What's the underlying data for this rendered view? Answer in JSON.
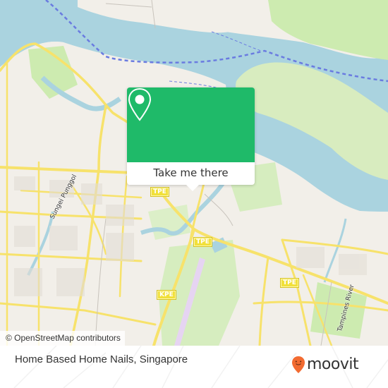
{
  "map": {
    "attribution": "© OpenStreetMap contributors",
    "highway_shields": [
      {
        "label": "TPE"
      },
      {
        "label": "TPE"
      },
      {
        "label": "TPE"
      },
      {
        "label": "KPE"
      }
    ],
    "road_labels": [
      {
        "label": "Sungei Punggol"
      },
      {
        "label": "Tampines River"
      }
    ],
    "colors": {
      "water": "#aad3df",
      "land": "#f2efe9",
      "park": "#cdebb0",
      "road": "#f7e26b",
      "shipping_lane": "#6a7be0"
    }
  },
  "popup": {
    "action_label": "Take me there",
    "icon": "location-pin-icon",
    "accent_color": "#1fba69"
  },
  "footer": {
    "place_name": "Home Based Home Nails, Singapore",
    "brand": {
      "name": "moovit",
      "icon": "moovit-pin-logo-icon",
      "color": "#f26b31"
    }
  }
}
